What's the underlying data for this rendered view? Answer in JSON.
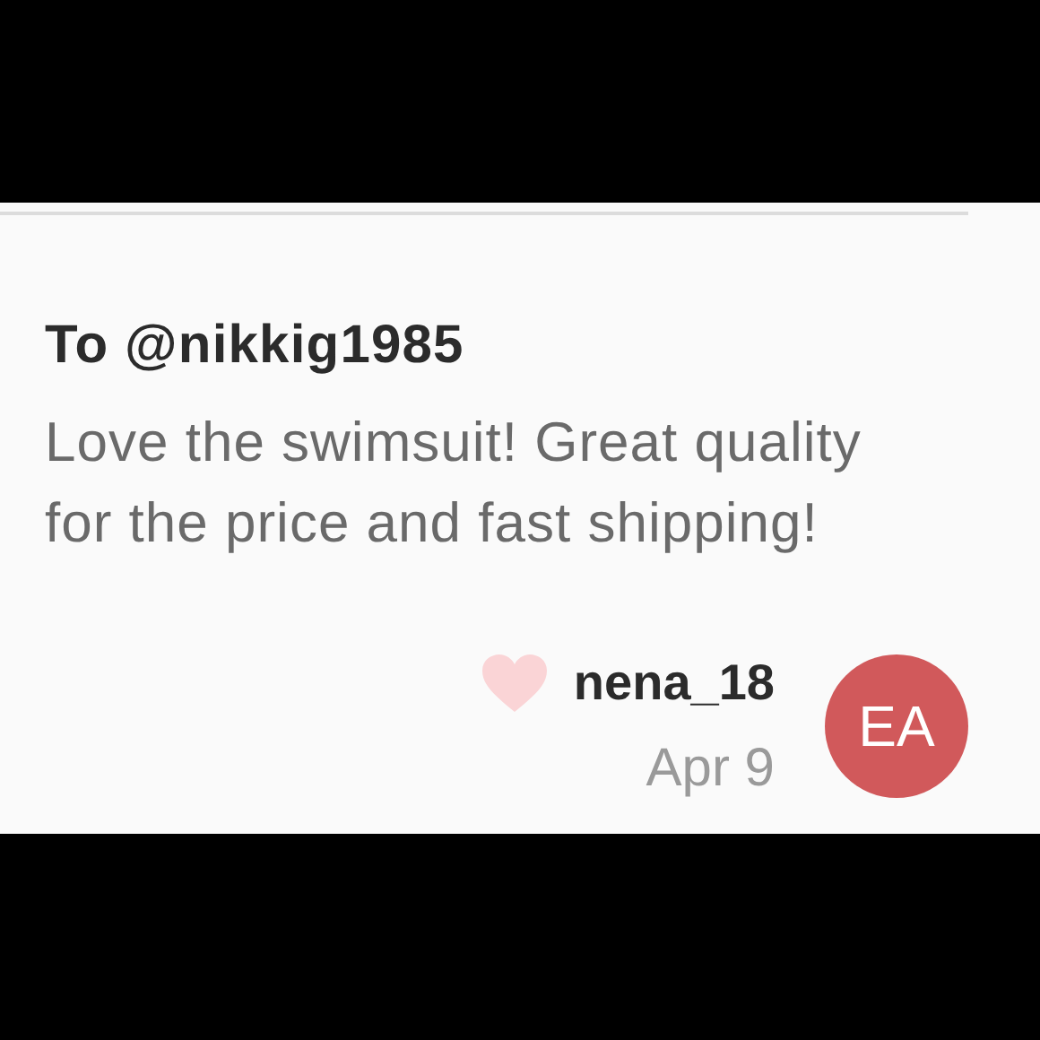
{
  "comment": {
    "recipient": "To @nikkig1985",
    "text": "Love the swimsuit! Great quality for the price and fast shipping!",
    "liked": false,
    "author": "nena_18",
    "date": "Apr 9",
    "avatar_initials": "EA"
  }
}
